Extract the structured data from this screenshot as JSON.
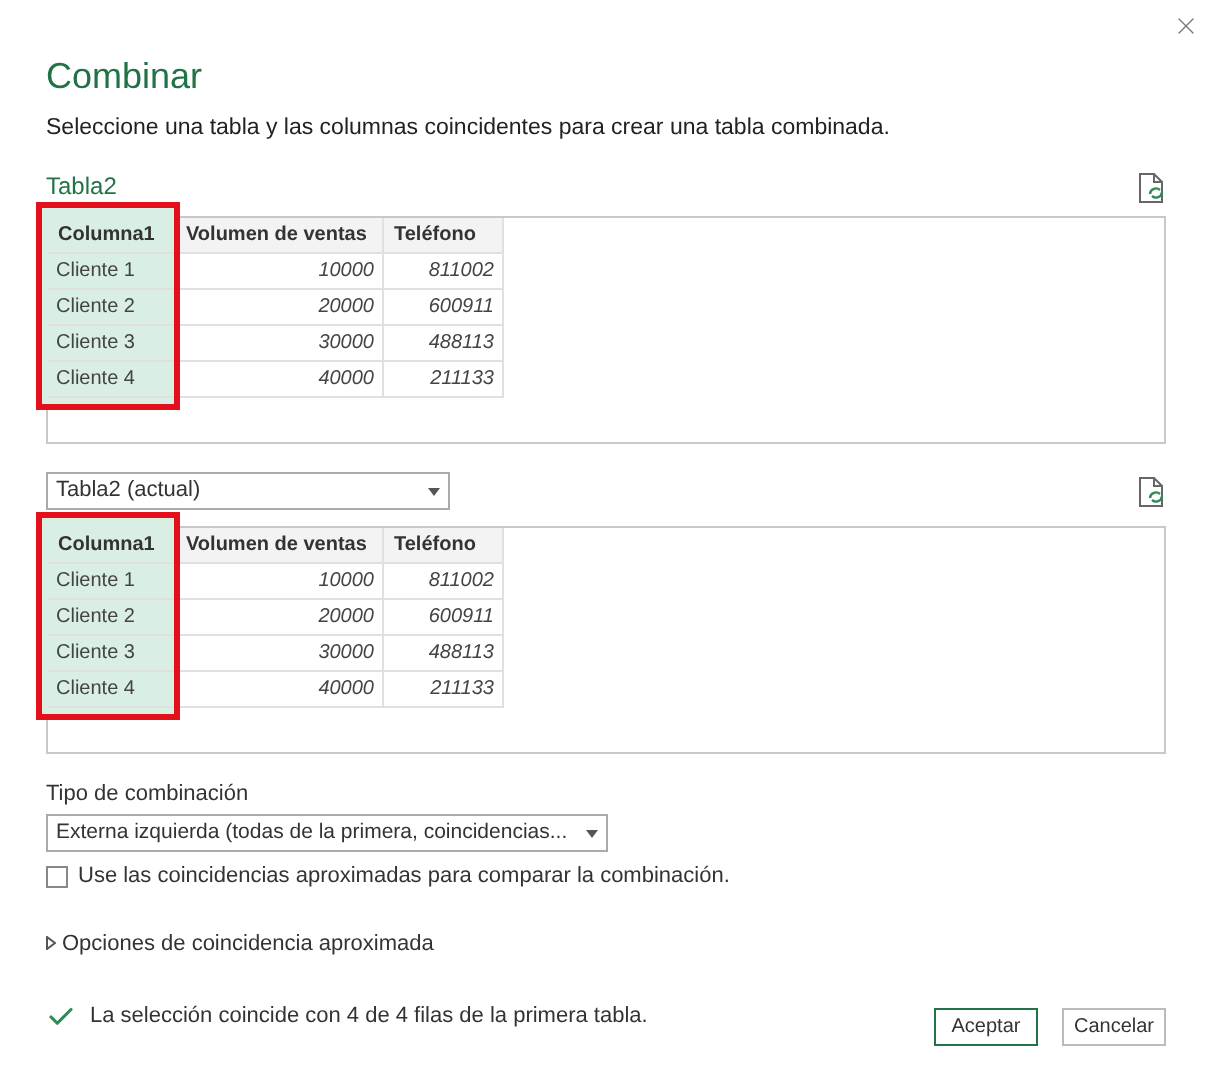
{
  "window": {
    "title": "Combinar"
  },
  "description": "Seleccione una tabla y las columnas coincidentes para crear una tabla combinada.",
  "first_table": {
    "name": "Tabla2",
    "columns": [
      {
        "header": "Columna1",
        "selected": true,
        "kind": "text",
        "cells": [
          "Cliente 1",
          "Cliente 2",
          "Cliente 3",
          "Cliente 4"
        ]
      },
      {
        "header": "Volumen de ventas",
        "selected": false,
        "kind": "number",
        "cells": [
          "10000",
          "20000",
          "30000",
          "40000"
        ]
      },
      {
        "header": "Teléfono",
        "selected": false,
        "kind": "number",
        "cells": [
          "811002",
          "600911",
          "488113",
          "211133"
        ]
      }
    ]
  },
  "second_table": {
    "dropdown": "Tabla2 (actual)",
    "columns": [
      {
        "header": "Columna1",
        "selected": true,
        "kind": "text",
        "cells": [
          "Cliente 1",
          "Cliente 2",
          "Cliente 3",
          "Cliente 4"
        ]
      },
      {
        "header": "Volumen de ventas",
        "selected": false,
        "kind": "number",
        "cells": [
          "10000",
          "20000",
          "30000",
          "40000"
        ]
      },
      {
        "header": "Teléfono",
        "selected": false,
        "kind": "number",
        "cells": [
          "811002",
          "600911",
          "488113",
          "211133"
        ]
      }
    ]
  },
  "join_kind": {
    "label": "Tipo de combinación",
    "value": "Externa izquierda (todas de la primera, coincidencias..."
  },
  "fuzzy_checkbox": {
    "label": "Use las coincidencias aproximadas para comparar la combinación.",
    "checked": false
  },
  "fuzzy_options": {
    "label": "Opciones de coincidencia aproximada",
    "expanded": false
  },
  "status": "La selección coincide con 4 de 4 filas de la primera tabla.",
  "buttons": [
    {
      "label": "Aceptar",
      "kind": "primary"
    },
    {
      "label": "Cancelar",
      "kind": "secondary"
    }
  ]
}
